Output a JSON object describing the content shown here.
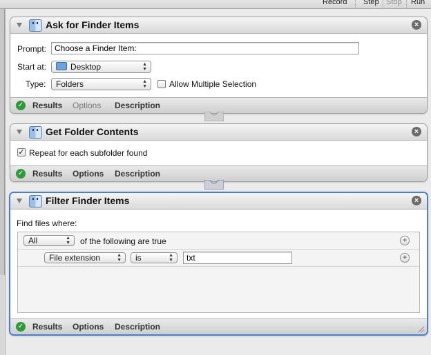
{
  "toolbar": {
    "record": "Record",
    "step": "Step",
    "stop": "Stop",
    "run": "Run"
  },
  "actions": [
    {
      "title": "Ask for Finder Items",
      "prompt_label": "Prompt:",
      "prompt_value": "Choose a Finder Item:",
      "start_label": "Start at:",
      "start_value": "Desktop",
      "type_label": "Type:",
      "type_value": "Folders",
      "allow_multiple_label": "Allow Multiple Selection",
      "allow_multiple_checked": false,
      "footer": {
        "results": "Results",
        "options": "Options",
        "description": "Description"
      }
    },
    {
      "title": "Get Folder Contents",
      "repeat_label": "Repeat for each subfolder found",
      "repeat_checked": true,
      "footer": {
        "results": "Results",
        "options": "Options",
        "description": "Description"
      }
    },
    {
      "title": "Filter Finder Items",
      "find_label": "Find files where:",
      "match_value": "All",
      "match_suffix": "of the following are true",
      "criterion_attribute": "File extension",
      "criterion_operator": "is",
      "criterion_value": "txt",
      "footer": {
        "results": "Results",
        "options": "Options",
        "description": "Description"
      }
    }
  ],
  "icons": {
    "close": "×",
    "check": "✓",
    "checkbox_checked": "✓",
    "plus": "+",
    "popup_arrows": "▲▼"
  }
}
